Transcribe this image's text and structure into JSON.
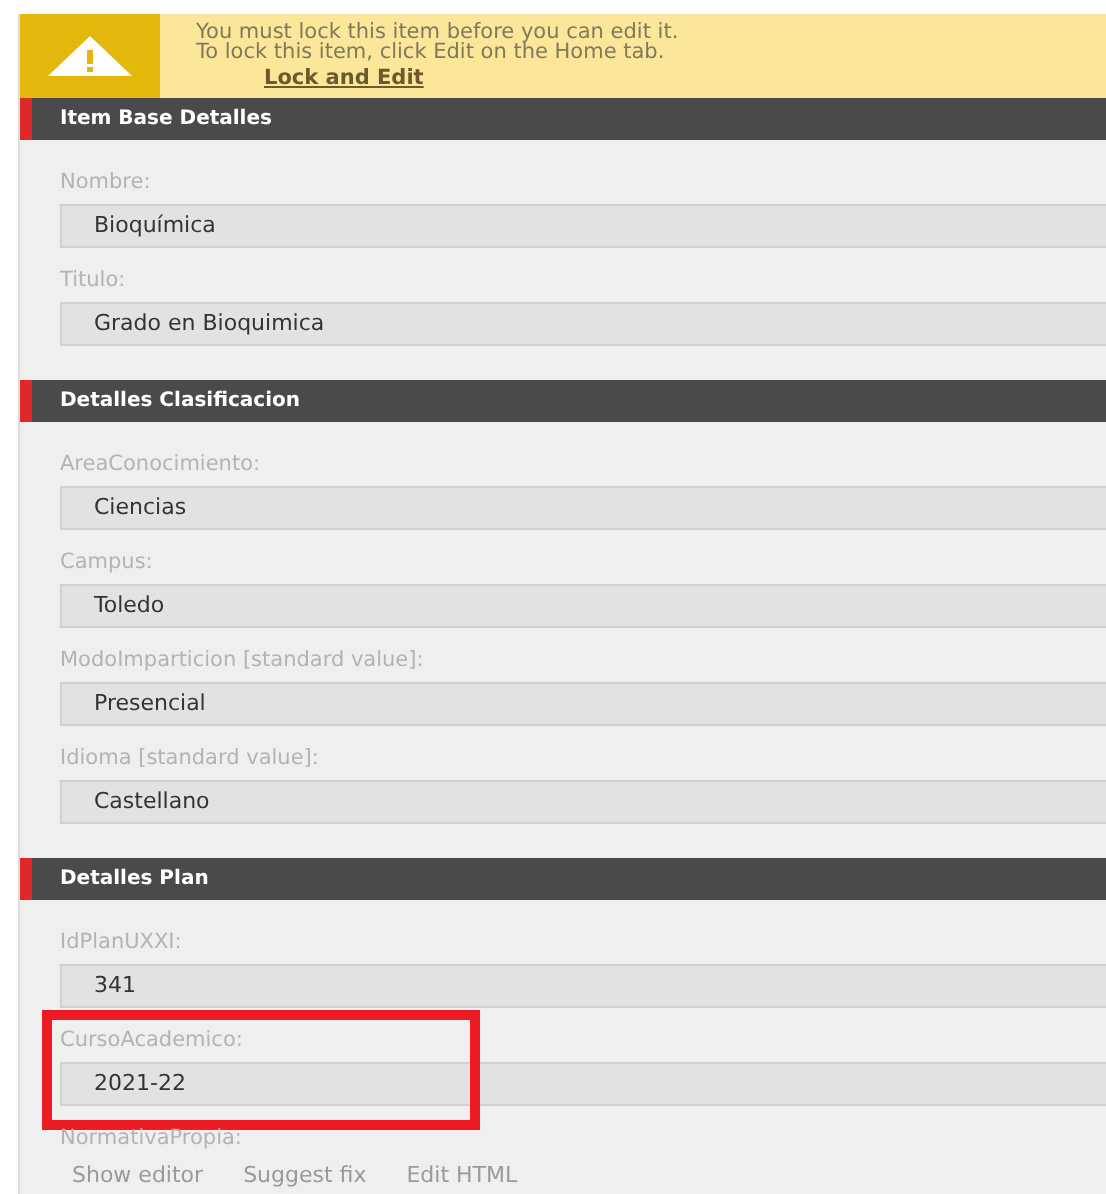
{
  "warning": {
    "lines": [
      "You must lock this item before you can edit it.",
      "To lock this item, click Edit on the Home tab."
    ],
    "link": "Lock and Edit"
  },
  "sections": [
    {
      "title": "Item Base Detalles",
      "fields": [
        {
          "kind": "input",
          "label": "Nombre:",
          "value": "Bioquímica",
          "highlighted": false
        },
        {
          "kind": "input",
          "label": "Titulo:",
          "value": "Grado en Bioquimica",
          "highlighted": false
        }
      ]
    },
    {
      "title": "Detalles Clasificacion",
      "fields": [
        {
          "kind": "input",
          "label": "AreaConocimiento:",
          "value": "Ciencias",
          "highlighted": false
        },
        {
          "kind": "input",
          "label": "Campus:",
          "value": "Toledo",
          "highlighted": false
        },
        {
          "kind": "input",
          "label": "ModoImparticion [standard value]:",
          "value": "Presencial",
          "highlighted": false
        },
        {
          "kind": "input",
          "label": "Idioma [standard value]:",
          "value": "Castellano",
          "highlighted": false
        }
      ]
    },
    {
      "title": "Detalles Plan",
      "fields": [
        {
          "kind": "input",
          "label": "IdPlanUXXI:",
          "value": "341",
          "highlighted": false
        },
        {
          "kind": "input",
          "label": "CursoAcademico:",
          "value": "2021-22",
          "highlighted": true
        },
        {
          "kind": "richtext",
          "label": "NormativaPropia:",
          "links": [
            "Show editor",
            "Suggest fix",
            "Edit HTML"
          ],
          "highlighted": false
        }
      ]
    }
  ]
}
